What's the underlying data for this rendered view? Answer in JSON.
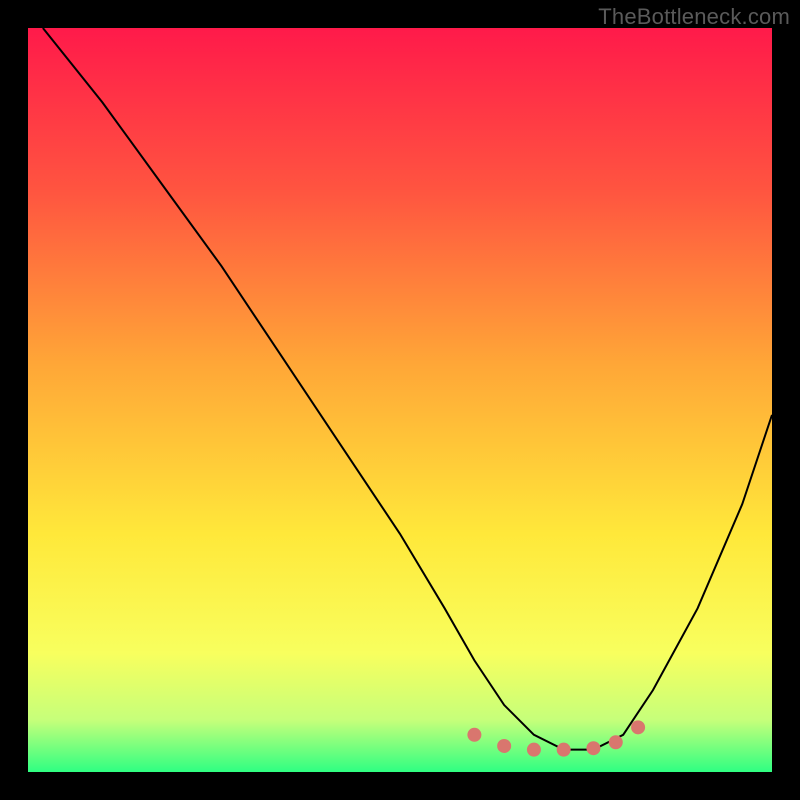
{
  "watermark": "TheBottleneck.com",
  "colors": {
    "frame": "#000000",
    "watermark": "#5a5a5a",
    "curve": "#000000",
    "marker": "#d9766e",
    "gradient_stops": [
      "#ff1a4a",
      "#ff5540",
      "#ffa637",
      "#ffe83a",
      "#f8ff5e",
      "#c6ff7a",
      "#2fff82"
    ]
  },
  "chart_data": {
    "type": "line",
    "title": "",
    "xlabel": "",
    "ylabel": "",
    "xlim": [
      0,
      100
    ],
    "ylim": [
      0,
      100
    ],
    "grid": false,
    "series": [
      {
        "name": "bottleneck-curve",
        "x": [
          2,
          10,
          18,
          26,
          34,
          42,
          50,
          56,
          60,
          64,
          68,
          72,
          76,
          80,
          84,
          90,
          96,
          100
        ],
        "y": [
          100,
          90,
          79,
          68,
          56,
          44,
          32,
          22,
          15,
          9,
          5,
          3,
          3,
          5,
          11,
          22,
          36,
          48
        ]
      }
    ],
    "markers": {
      "name": "optimal-range",
      "points": [
        {
          "x": 60,
          "y": 5
        },
        {
          "x": 64,
          "y": 3.5
        },
        {
          "x": 68,
          "y": 3
        },
        {
          "x": 72,
          "y": 3
        },
        {
          "x": 76,
          "y": 3.2
        },
        {
          "x": 79,
          "y": 4
        },
        {
          "x": 82,
          "y": 6
        }
      ],
      "radius": 7
    },
    "background_type": "vertical-heatmap-gradient"
  }
}
